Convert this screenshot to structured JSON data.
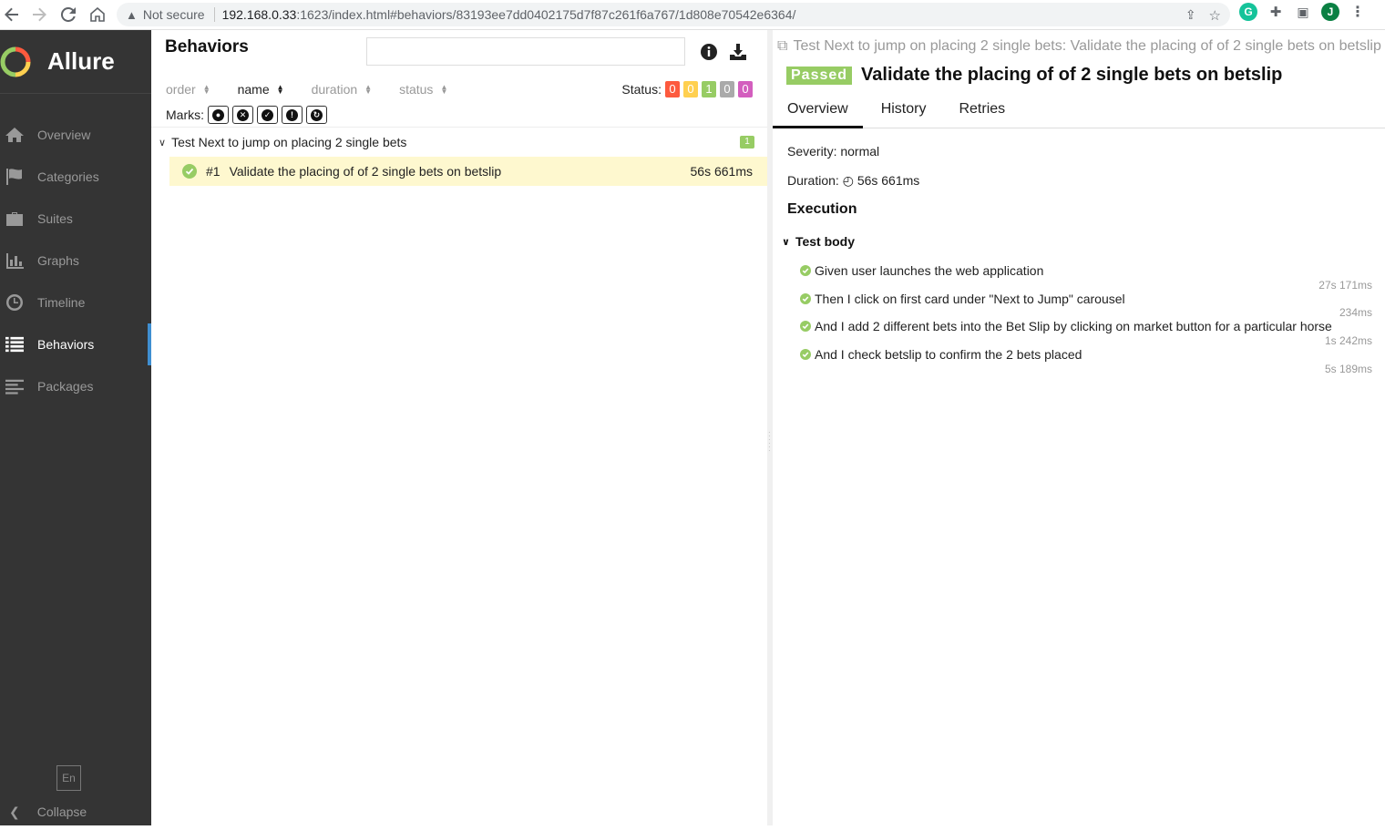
{
  "browser": {
    "not_secure": "Not secure",
    "url_host": "192.168.0.33",
    "url_rest": ":1623/index.html#behaviors/83193ee7dd0402175d7f87c261f6a767/1d808e70542e6364/",
    "profile_initial": "J"
  },
  "sidebar": {
    "brand": "Allure",
    "items": [
      {
        "label": "Overview"
      },
      {
        "label": "Categories"
      },
      {
        "label": "Suites"
      },
      {
        "label": "Graphs"
      },
      {
        "label": "Timeline"
      },
      {
        "label": "Behaviors"
      },
      {
        "label": "Packages"
      }
    ],
    "active_item": "Behaviors",
    "language": "En",
    "collapse": "Collapse"
  },
  "left_pane": {
    "title": "Behaviors",
    "sort": [
      "order",
      "name",
      "duration",
      "status"
    ],
    "status_label": "Status:",
    "status_counts": [
      {
        "value": "0",
        "color": "#fd5a3e"
      },
      {
        "value": "0",
        "color": "#ffd050"
      },
      {
        "value": "1",
        "color": "#97cc64"
      },
      {
        "value": "0",
        "color": "#aaaaaa"
      },
      {
        "value": "0",
        "color": "#d35ebe"
      }
    ],
    "marks_label": "Marks:",
    "group": {
      "name": "Test Next to jump on placing 2 single bets",
      "count": "1"
    },
    "test": {
      "number": "#1",
      "name": "Validate the placing of of 2 single bets on betslip",
      "duration": "56s 661ms"
    }
  },
  "right_pane": {
    "breadcrumb": "Test Next to jump on placing 2 single bets: Validate the placing of of 2 single bets on betslip",
    "status": "Passed",
    "title": "Validate the placing of of 2 single bets on betslip",
    "tabs": [
      "Overview",
      "History",
      "Retries"
    ],
    "severity": "Severity: normal",
    "duration_label": "Duration:",
    "duration_value": "56s 661ms",
    "execution": "Execution",
    "test_body": "Test body",
    "steps": [
      {
        "name": "Given user launches the web application",
        "duration": "27s 171ms"
      },
      {
        "name": "Then I click on first card under \"Next to Jump\" carousel",
        "duration": "234ms"
      },
      {
        "name": "And I add 2 different bets into the Bet Slip by clicking on market button for a particular horse",
        "duration": "1s 242ms"
      },
      {
        "name": "And I check betslip to confirm the 2 bets placed",
        "duration": "5s 189ms"
      }
    ]
  }
}
